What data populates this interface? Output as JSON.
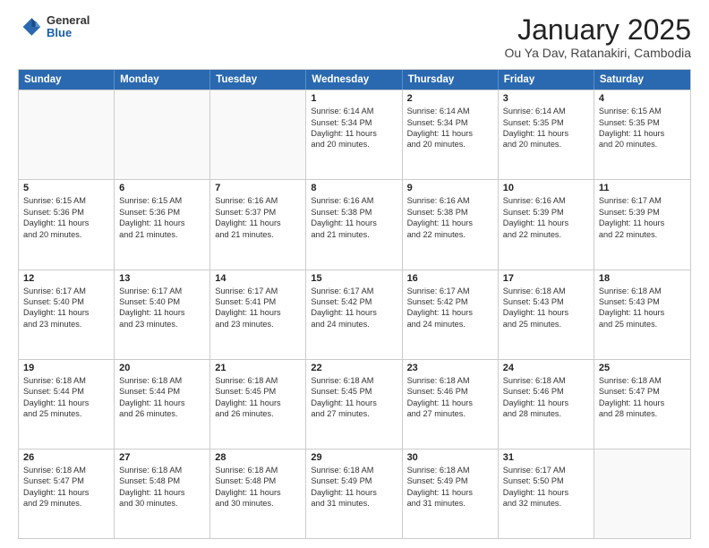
{
  "header": {
    "logo_general": "General",
    "logo_blue": "Blue",
    "month_title": "January 2025",
    "location": "Ou Ya Dav, Ratanakiri, Cambodia"
  },
  "weekdays": [
    "Sunday",
    "Monday",
    "Tuesday",
    "Wednesday",
    "Thursday",
    "Friday",
    "Saturday"
  ],
  "rows": [
    [
      {
        "day": "",
        "lines": []
      },
      {
        "day": "",
        "lines": []
      },
      {
        "day": "",
        "lines": []
      },
      {
        "day": "1",
        "lines": [
          "Sunrise: 6:14 AM",
          "Sunset: 5:34 PM",
          "Daylight: 11 hours",
          "and 20 minutes."
        ]
      },
      {
        "day": "2",
        "lines": [
          "Sunrise: 6:14 AM",
          "Sunset: 5:34 PM",
          "Daylight: 11 hours",
          "and 20 minutes."
        ]
      },
      {
        "day": "3",
        "lines": [
          "Sunrise: 6:14 AM",
          "Sunset: 5:35 PM",
          "Daylight: 11 hours",
          "and 20 minutes."
        ]
      },
      {
        "day": "4",
        "lines": [
          "Sunrise: 6:15 AM",
          "Sunset: 5:35 PM",
          "Daylight: 11 hours",
          "and 20 minutes."
        ]
      }
    ],
    [
      {
        "day": "5",
        "lines": [
          "Sunrise: 6:15 AM",
          "Sunset: 5:36 PM",
          "Daylight: 11 hours",
          "and 20 minutes."
        ]
      },
      {
        "day": "6",
        "lines": [
          "Sunrise: 6:15 AM",
          "Sunset: 5:36 PM",
          "Daylight: 11 hours",
          "and 21 minutes."
        ]
      },
      {
        "day": "7",
        "lines": [
          "Sunrise: 6:16 AM",
          "Sunset: 5:37 PM",
          "Daylight: 11 hours",
          "and 21 minutes."
        ]
      },
      {
        "day": "8",
        "lines": [
          "Sunrise: 6:16 AM",
          "Sunset: 5:38 PM",
          "Daylight: 11 hours",
          "and 21 minutes."
        ]
      },
      {
        "day": "9",
        "lines": [
          "Sunrise: 6:16 AM",
          "Sunset: 5:38 PM",
          "Daylight: 11 hours",
          "and 22 minutes."
        ]
      },
      {
        "day": "10",
        "lines": [
          "Sunrise: 6:16 AM",
          "Sunset: 5:39 PM",
          "Daylight: 11 hours",
          "and 22 minutes."
        ]
      },
      {
        "day": "11",
        "lines": [
          "Sunrise: 6:17 AM",
          "Sunset: 5:39 PM",
          "Daylight: 11 hours",
          "and 22 minutes."
        ]
      }
    ],
    [
      {
        "day": "12",
        "lines": [
          "Sunrise: 6:17 AM",
          "Sunset: 5:40 PM",
          "Daylight: 11 hours",
          "and 23 minutes."
        ]
      },
      {
        "day": "13",
        "lines": [
          "Sunrise: 6:17 AM",
          "Sunset: 5:40 PM",
          "Daylight: 11 hours",
          "and 23 minutes."
        ]
      },
      {
        "day": "14",
        "lines": [
          "Sunrise: 6:17 AM",
          "Sunset: 5:41 PM",
          "Daylight: 11 hours",
          "and 23 minutes."
        ]
      },
      {
        "day": "15",
        "lines": [
          "Sunrise: 6:17 AM",
          "Sunset: 5:42 PM",
          "Daylight: 11 hours",
          "and 24 minutes."
        ]
      },
      {
        "day": "16",
        "lines": [
          "Sunrise: 6:17 AM",
          "Sunset: 5:42 PM",
          "Daylight: 11 hours",
          "and 24 minutes."
        ]
      },
      {
        "day": "17",
        "lines": [
          "Sunrise: 6:18 AM",
          "Sunset: 5:43 PM",
          "Daylight: 11 hours",
          "and 25 minutes."
        ]
      },
      {
        "day": "18",
        "lines": [
          "Sunrise: 6:18 AM",
          "Sunset: 5:43 PM",
          "Daylight: 11 hours",
          "and 25 minutes."
        ]
      }
    ],
    [
      {
        "day": "19",
        "lines": [
          "Sunrise: 6:18 AM",
          "Sunset: 5:44 PM",
          "Daylight: 11 hours",
          "and 25 minutes."
        ]
      },
      {
        "day": "20",
        "lines": [
          "Sunrise: 6:18 AM",
          "Sunset: 5:44 PM",
          "Daylight: 11 hours",
          "and 26 minutes."
        ]
      },
      {
        "day": "21",
        "lines": [
          "Sunrise: 6:18 AM",
          "Sunset: 5:45 PM",
          "Daylight: 11 hours",
          "and 26 minutes."
        ]
      },
      {
        "day": "22",
        "lines": [
          "Sunrise: 6:18 AM",
          "Sunset: 5:45 PM",
          "Daylight: 11 hours",
          "and 27 minutes."
        ]
      },
      {
        "day": "23",
        "lines": [
          "Sunrise: 6:18 AM",
          "Sunset: 5:46 PM",
          "Daylight: 11 hours",
          "and 27 minutes."
        ]
      },
      {
        "day": "24",
        "lines": [
          "Sunrise: 6:18 AM",
          "Sunset: 5:46 PM",
          "Daylight: 11 hours",
          "and 28 minutes."
        ]
      },
      {
        "day": "25",
        "lines": [
          "Sunrise: 6:18 AM",
          "Sunset: 5:47 PM",
          "Daylight: 11 hours",
          "and 28 minutes."
        ]
      }
    ],
    [
      {
        "day": "26",
        "lines": [
          "Sunrise: 6:18 AM",
          "Sunset: 5:47 PM",
          "Daylight: 11 hours",
          "and 29 minutes."
        ]
      },
      {
        "day": "27",
        "lines": [
          "Sunrise: 6:18 AM",
          "Sunset: 5:48 PM",
          "Daylight: 11 hours",
          "and 30 minutes."
        ]
      },
      {
        "day": "28",
        "lines": [
          "Sunrise: 6:18 AM",
          "Sunset: 5:48 PM",
          "Daylight: 11 hours",
          "and 30 minutes."
        ]
      },
      {
        "day": "29",
        "lines": [
          "Sunrise: 6:18 AM",
          "Sunset: 5:49 PM",
          "Daylight: 11 hours",
          "and 31 minutes."
        ]
      },
      {
        "day": "30",
        "lines": [
          "Sunrise: 6:18 AM",
          "Sunset: 5:49 PM",
          "Daylight: 11 hours",
          "and 31 minutes."
        ]
      },
      {
        "day": "31",
        "lines": [
          "Sunrise: 6:17 AM",
          "Sunset: 5:50 PM",
          "Daylight: 11 hours",
          "and 32 minutes."
        ]
      },
      {
        "day": "",
        "lines": []
      }
    ]
  ]
}
